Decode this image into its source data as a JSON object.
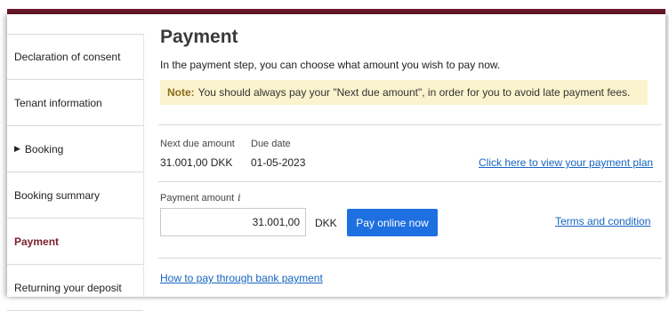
{
  "sidebar": {
    "items": [
      {
        "label": "Declaration of consent"
      },
      {
        "label": "Tenant information"
      },
      {
        "label": "Booking"
      },
      {
        "label": "Booking summary"
      },
      {
        "label": "Payment"
      },
      {
        "label": "Returning your deposit"
      }
    ]
  },
  "main": {
    "title": "Payment",
    "subtitle": "In the payment step, you can choose what amount you wish to pay now.",
    "note_label": "Note:",
    "note_text": "You should always pay your \"Next due amount\", in order for you to avoid late payment fees.",
    "next_due_label": "Next due amount",
    "next_due_value": "31.001,00 DKK",
    "due_date_label": "Due date",
    "due_date_value": "01-05-2023",
    "payment_plan_link": "Click here to view your payment plan",
    "payment_amount_label": "Payment amount",
    "info_glyph": "i",
    "payment_amount_value": "31.001,00",
    "currency": "DKK",
    "pay_button": "Pay online now",
    "terms_link": "Terms and condition",
    "bank_payment_link": "How to pay through bank payment"
  },
  "colors": {
    "accent_burgundy": "#6e1a2a",
    "link_blue": "#1565c0",
    "button_blue": "#1e6fe0",
    "note_bg": "#fbf3cd"
  }
}
